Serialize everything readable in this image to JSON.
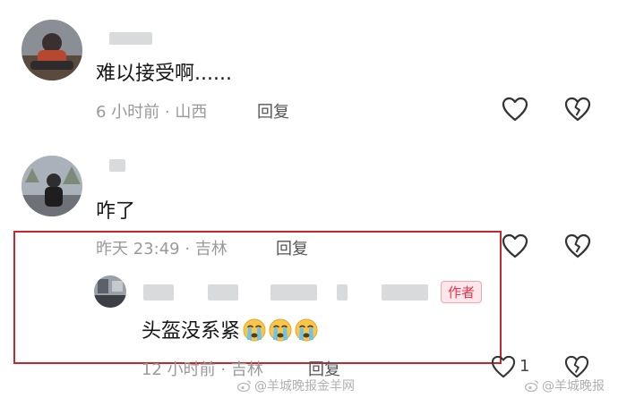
{
  "comments": [
    {
      "text": "难以接受啊......",
      "time": "6 小时前",
      "location": "山西",
      "reply_label": "回复"
    },
    {
      "text": "咋了",
      "time": "昨天 23:49",
      "location": "吉林",
      "reply_label": "回复"
    }
  ],
  "reply": {
    "text": "头盔没系紧",
    "emoji": [
      "crying-face",
      "crying-face",
      "crying-face"
    ],
    "time": "12 小时前",
    "location": "吉林",
    "reply_label": "回复",
    "badge": "作者",
    "like_count": "1"
  },
  "separator": "·",
  "watermark": {
    "left": "@羊城晚报金羊网",
    "right": "@羊城晚报"
  },
  "colors": {
    "highlight_border": "#c6262e",
    "author_badge": "#e8344d",
    "meta_text": "#9a9a9a"
  }
}
